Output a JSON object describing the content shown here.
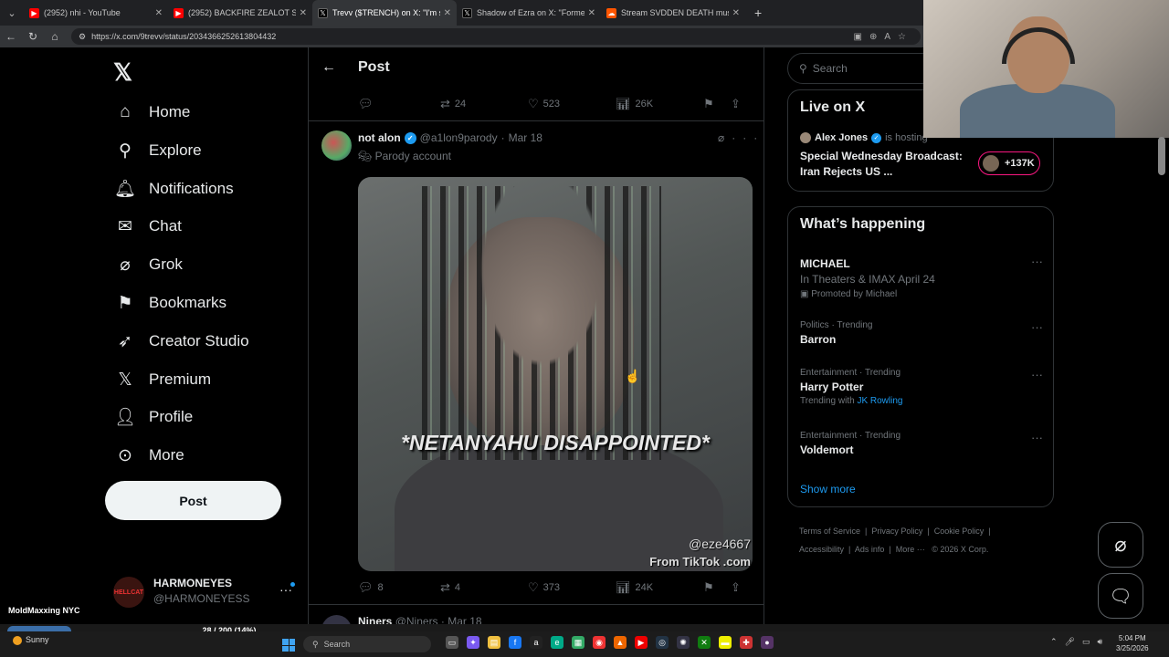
{
  "browser": {
    "tabs": [
      {
        "title": "(2952) nhi - YouTube",
        "favicon": "youtube-icon",
        "color": "#ff0000"
      },
      {
        "title": "(2952) BACKFIRE ZEALOT S3 electr",
        "favicon": "youtube-icon",
        "color": "#ff0000"
      },
      {
        "title": "Trevv ($TRENCH) on X: \"I'm smokin",
        "favicon": "x-icon",
        "color": "#000000"
      },
      {
        "title": "Shadow of Ezra on X: \"Former CIA",
        "favicon": "x-icon",
        "color": "#000000"
      },
      {
        "title": "Stream SVDDEN DEATH music | Lis",
        "favicon": "soundcloud-icon",
        "color": "#ff5500"
      }
    ],
    "url": "https://x.com/9trevv/status/2034366252613804432"
  },
  "sidebar": {
    "nav": [
      {
        "label": "Home",
        "icon": "home-icon"
      },
      {
        "label": "Explore",
        "icon": "search-icon"
      },
      {
        "label": "Notifications",
        "icon": "bell-icon"
      },
      {
        "label": "Chat",
        "icon": "mail-icon"
      },
      {
        "label": "Grok",
        "icon": "grok-icon"
      },
      {
        "label": "Bookmarks",
        "icon": "bookmark-icon"
      },
      {
        "label": "Creator Studio",
        "icon": "rocket-icon"
      },
      {
        "label": "Premium",
        "icon": "x-logo-icon"
      },
      {
        "label": "Profile",
        "icon": "person-icon"
      },
      {
        "label": "More",
        "icon": "more-circle-icon"
      }
    ],
    "post_label": "Post",
    "account": {
      "name": "HARMONEYES",
      "handle": "@HARMONEYESS",
      "avatar_text": "HELLCAT"
    }
  },
  "feed": {
    "header_title": "Post",
    "prev_actions": {
      "replies": "",
      "reposts": "24",
      "likes": "523",
      "views": "26K"
    },
    "tweet": {
      "name": "not alon",
      "handle": "@a1lon9parody",
      "date": "Mar 18",
      "label": "Parody account",
      "caption": "*NETANYAHU DISAPPOINTED*",
      "watermark_user": "@eze4667",
      "watermark_source": "From TikTok .com",
      "actions": {
        "replies": "8",
        "reposts": "4",
        "likes": "373",
        "views": "24K"
      }
    },
    "next": {
      "name": "Niners",
      "handle": "@Niners",
      "date": "Mar 18"
    }
  },
  "right": {
    "search_placeholder": "Search",
    "live": {
      "heading": "Live on X",
      "host_name": "Alex Jones",
      "host_suffix": "is hosting",
      "title": "Special Wednesday Broadcast: Iran Rejects US ...",
      "count": "+137K"
    },
    "happening": {
      "heading": "What’s happening",
      "trends": [
        {
          "category": "",
          "name": "MICHAEL",
          "sub": "In Theaters & IMAX April 24",
          "promo": "Promoted by Michael"
        },
        {
          "category": "Politics · Trending",
          "name": "Barron"
        },
        {
          "category": "Entertainment · Trending",
          "name": "Harry Potter",
          "with_prefix": "Trending with",
          "with_link": "JK Rowling"
        },
        {
          "category": "Entertainment · Trending",
          "name": "Voldemort"
        }
      ],
      "show_more": "Show more"
    },
    "footer": [
      "Terms of Service",
      "Privacy Policy",
      "Cookie Policy",
      "Accessibility",
      "Ads info",
      "More ···",
      "© 2026 X Corp."
    ]
  },
  "overlay": {
    "streamer_name": "MoldMaxxing NYC",
    "progress_text": "28 / 200 (14%)",
    "progress_fraction": 0.14
  },
  "taskbar": {
    "weather": "Sunny",
    "search_placeholder": "Search",
    "time": "5:04 PM",
    "date": "3/25/2026"
  }
}
